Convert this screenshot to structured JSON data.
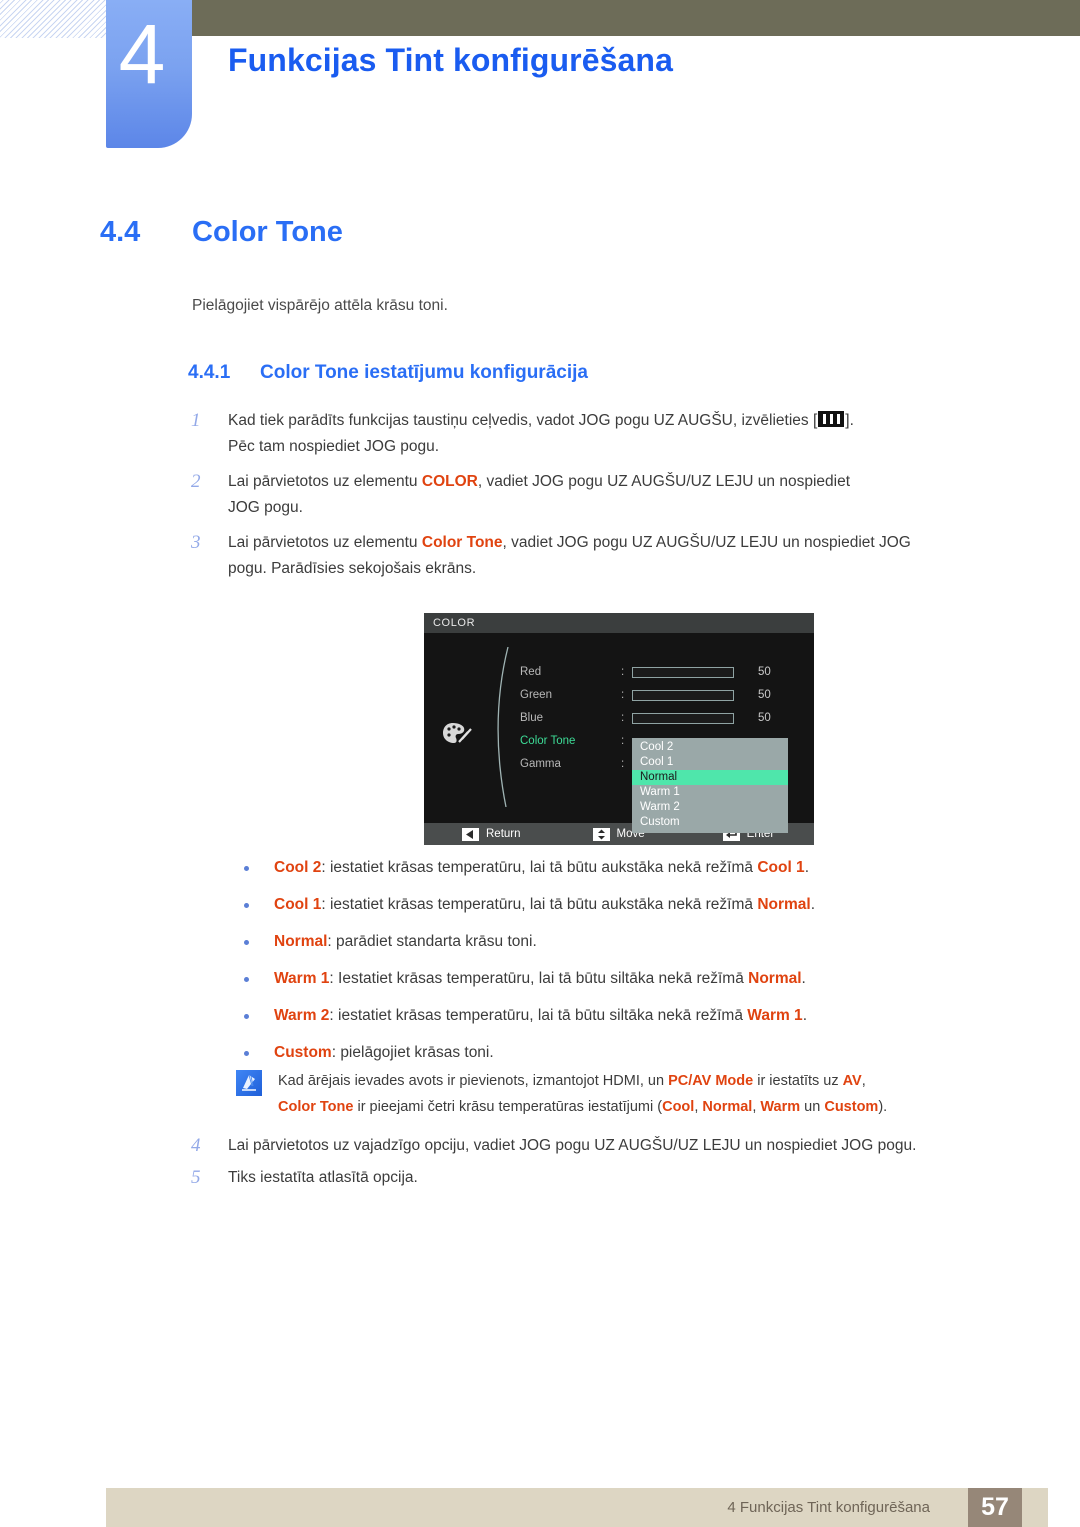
{
  "header": {
    "chapter_number": "4",
    "chapter_title": "Funkcijas Tint  konfigurēšana"
  },
  "section": {
    "number": "4.4",
    "title": "Color Tone",
    "intro": "Pielāgojiet vispārējo attēla krāsu toni.",
    "subsection_number": "4.4.1",
    "subsection_title": "Color Tone iestatījumu konfigurācija"
  },
  "steps": [
    {
      "index": "1",
      "line1_a": "Kad tiek parādīts funkcijas taustiņu ceļvedis, vadot JOG pogu UZ AUGŠU, izvēlieties [",
      "icon": "menu-bars-icon",
      "line1_b": "].",
      "line2": "Pēc tam nospiediet JOG pogu."
    },
    {
      "index": "2",
      "line1_a": "Lai pārvietotos uz elementu ",
      "emph": "COLOR",
      "line1_b": ", vadiet JOG pogu UZ AUGŠU/UZ LEJU un nospiediet",
      "line2": "JOG pogu."
    },
    {
      "index": "3",
      "line1_a": "Lai pārvietotos uz elementu ",
      "emph": "Color Tone",
      "line1_b": ", vadiet JOG pogu UZ AUGŠU/UZ LEJU un nospiediet JOG",
      "line2": "pogu. Parādīsies sekojošais ekrāns."
    }
  ],
  "steps_after": [
    {
      "index": "4",
      "line1": "Lai pārvietotos uz vajadzīgo opciju, vadiet JOG pogu UZ AUGŠU/UZ LEJU un nospiediet JOG pogu."
    },
    {
      "index": "5",
      "line1": "Tiks iestatīta atlasītā opcija."
    }
  ],
  "osd": {
    "title": "COLOR",
    "palette_icon": "palette-icon",
    "rows": [
      {
        "label": "Red",
        "colon": ":",
        "value": "50",
        "fill_percent": 50
      },
      {
        "label": "Green",
        "colon": ":",
        "value": "50",
        "fill_percent": 50
      },
      {
        "label": "Blue",
        "colon": ":",
        "value": "50",
        "fill_percent": 50
      },
      {
        "label": "Color Tone",
        "colon": ":",
        "value": "",
        "fill_percent": 0
      },
      {
        "label": "Gamma",
        "colon": ":",
        "value": "",
        "fill_percent": 0
      }
    ],
    "dropdown_options": [
      "Cool 2",
      "Cool 1",
      "Normal",
      "Warm 1",
      "Warm 2",
      "Custom"
    ],
    "dropdown_selected": "Normal",
    "footer": [
      {
        "icon": "left-triangle-icon",
        "label": "Return"
      },
      {
        "icon": "up-down-arrow-icon",
        "label": "Move"
      },
      {
        "icon": "enter-arrow-icon",
        "label": "Enter"
      }
    ],
    "colors": {
      "title_bar": "#3b3e3e",
      "body": "#141414",
      "dropdown_bg": "#9aa8a8",
      "highlight": "#4fe6ab",
      "active_label": "#3ddc97",
      "footer_bar": "#4a4d4d",
      "slider_fill": "#a9bcbc"
    }
  },
  "bullets": [
    {
      "term": "Cool 2",
      "mid": ": iestatiet krāsas temperatūru, lai tā būtu aukstāka nekā režīmā ",
      "term2": "Cool 1",
      "end": "."
    },
    {
      "term": "Cool 1",
      "mid": ": iestatiet krāsas temperatūru, lai tā būtu aukstāka nekā režīmā ",
      "term2": "Normal",
      "end": "."
    },
    {
      "term": "Normal",
      "mid": ": parādiet standarta krāsu toni.",
      "term2": "",
      "end": ""
    },
    {
      "term": "Warm 1",
      "mid": ": Iestatiet krāsas temperatūru, lai tā būtu siltāka nekā režīmā ",
      "term2": "Normal",
      "end": "."
    },
    {
      "term": "Warm 2",
      "mid": ": iestatiet krāsas temperatūru, lai tā būtu siltāka nekā režīmā ",
      "term2": "Warm 1",
      "end": "."
    },
    {
      "term": "Custom",
      "mid": ": pielāgojiet krāsas toni.",
      "term2": "",
      "end": ""
    }
  ],
  "note": {
    "icon": "note-pen-icon",
    "l1_a": "Kad ārējais ievades avots ir pievienots, izmantojot HDMI, un ",
    "l1_em1": "PC/AV Mode",
    "l1_b": " ir iestatīts uz ",
    "l1_em2": "AV",
    "l1_c": ",",
    "l2_em1": "Color Tone",
    "l2_a": " ir pieejami četri krāsu temperatūras iestatījumi (",
    "l2_em2": "Cool",
    "l2_b": ", ",
    "l2_em3": "Normal",
    "l2_c": ", ",
    "l2_em4": "Warm",
    "l2_d": " un ",
    "l2_em5": "Custom",
    "l2_e": ")."
  },
  "footer": {
    "text": "4 Funkcijas Tint  konfigurēšana",
    "page_number": "57"
  },
  "colors": {
    "accent_blue": "#2a6ef5",
    "emph_red": "#e04310",
    "body_text": "#3c3c3c",
    "olive": "#6d6c58",
    "footer_beige": "#ddd6c3",
    "footer_page_box": "#968778"
  }
}
